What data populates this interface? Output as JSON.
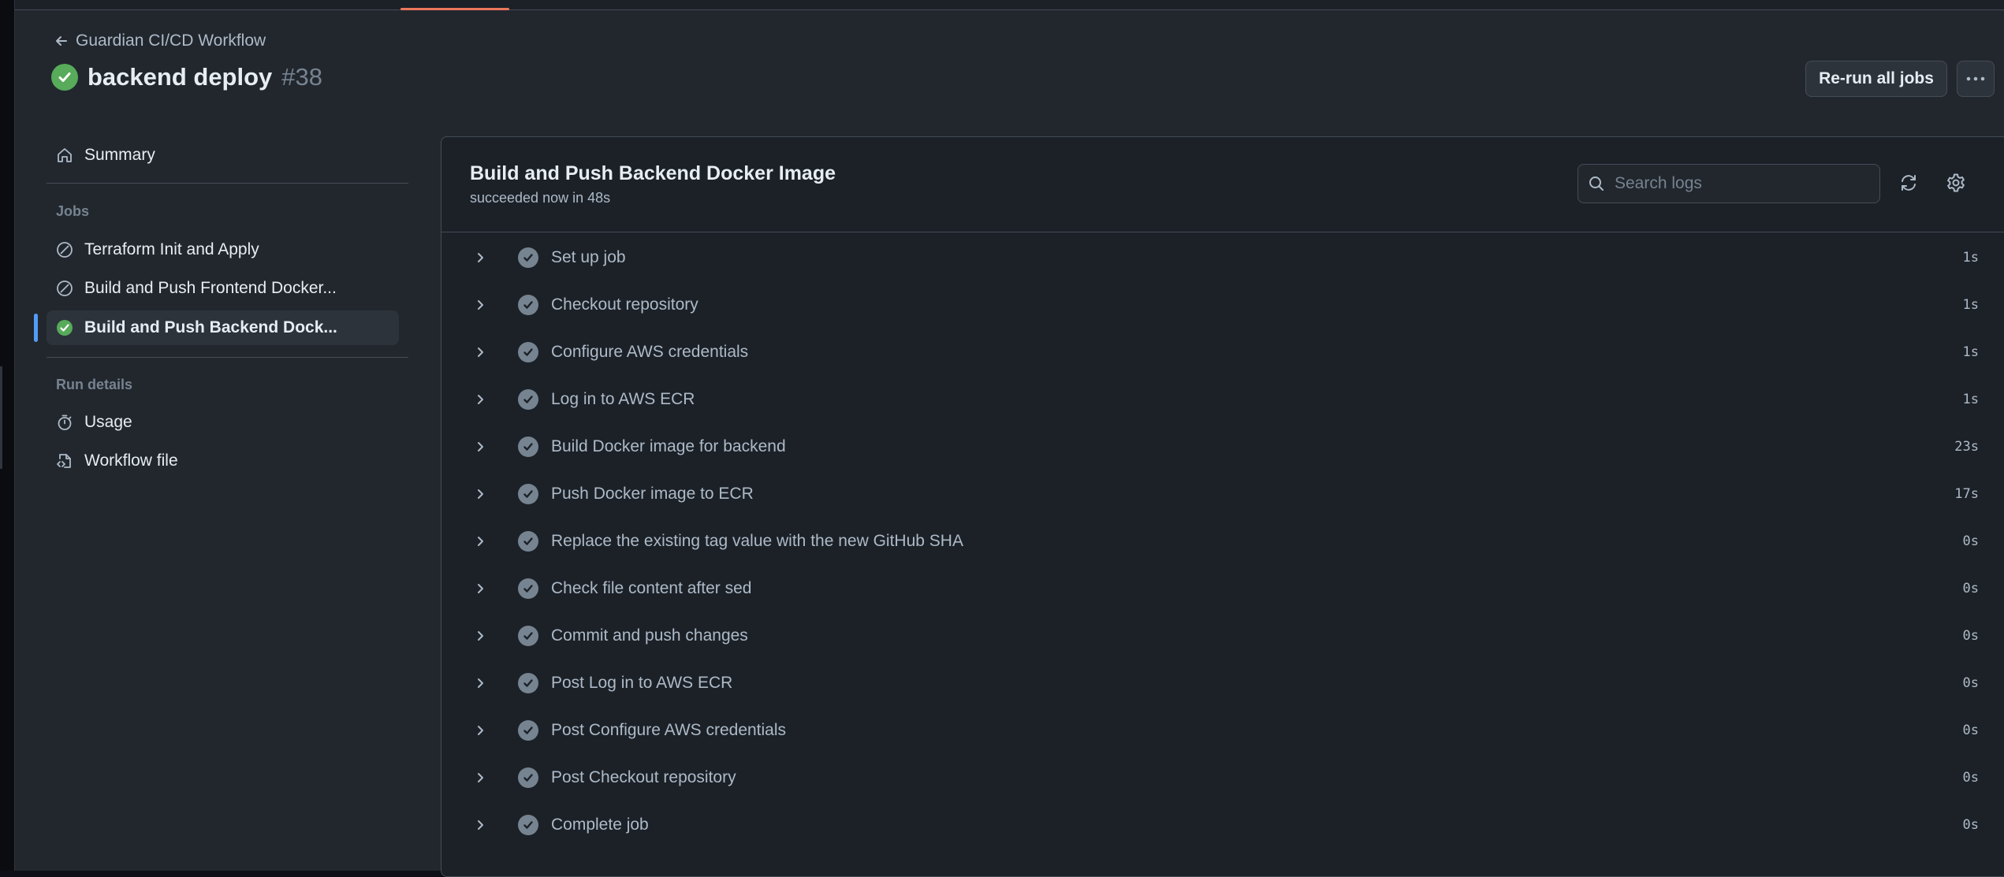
{
  "header": {
    "back_label": "Guardian CI/CD Workflow",
    "run_name": "backend deploy",
    "run_number": "#38",
    "rerun_label": "Re-run all jobs"
  },
  "sidebar": {
    "summary_label": "Summary",
    "jobs_heading": "Jobs",
    "jobs": [
      {
        "label": "Terraform Init and Apply",
        "status": "skipped"
      },
      {
        "label": "Build and Push Frontend Docker...",
        "status": "skipped"
      },
      {
        "label": "Build and Push Backend Dock...",
        "status": "success"
      }
    ],
    "run_details_heading": "Run details",
    "usage_label": "Usage",
    "workflow_file_label": "Workflow file"
  },
  "job": {
    "title": "Build and Push Backend Docker Image",
    "subtitle": "succeeded now in 48s",
    "search_placeholder": "Search logs"
  },
  "steps": [
    {
      "name": "Set up job",
      "duration": "1s"
    },
    {
      "name": "Checkout repository",
      "duration": "1s"
    },
    {
      "name": "Configure AWS credentials",
      "duration": "1s"
    },
    {
      "name": "Log in to AWS ECR",
      "duration": "1s"
    },
    {
      "name": "Build Docker image for backend",
      "duration": "23s"
    },
    {
      "name": "Push Docker image to ECR",
      "duration": "17s"
    },
    {
      "name": "Replace the existing tag value with the new GitHub SHA",
      "duration": "0s"
    },
    {
      "name": "Check file content after sed",
      "duration": "0s"
    },
    {
      "name": "Commit and push changes",
      "duration": "0s"
    },
    {
      "name": "Post Log in to AWS ECR",
      "duration": "0s"
    },
    {
      "name": "Post Configure AWS credentials",
      "duration": "0s"
    },
    {
      "name": "Post Checkout repository",
      "duration": "0s"
    },
    {
      "name": "Complete job",
      "duration": "0s"
    }
  ],
  "colors": {
    "success": "#57ab5a",
    "accent": "#539bf5",
    "tab_underline": "#ec775c",
    "step_check": "#768390"
  }
}
